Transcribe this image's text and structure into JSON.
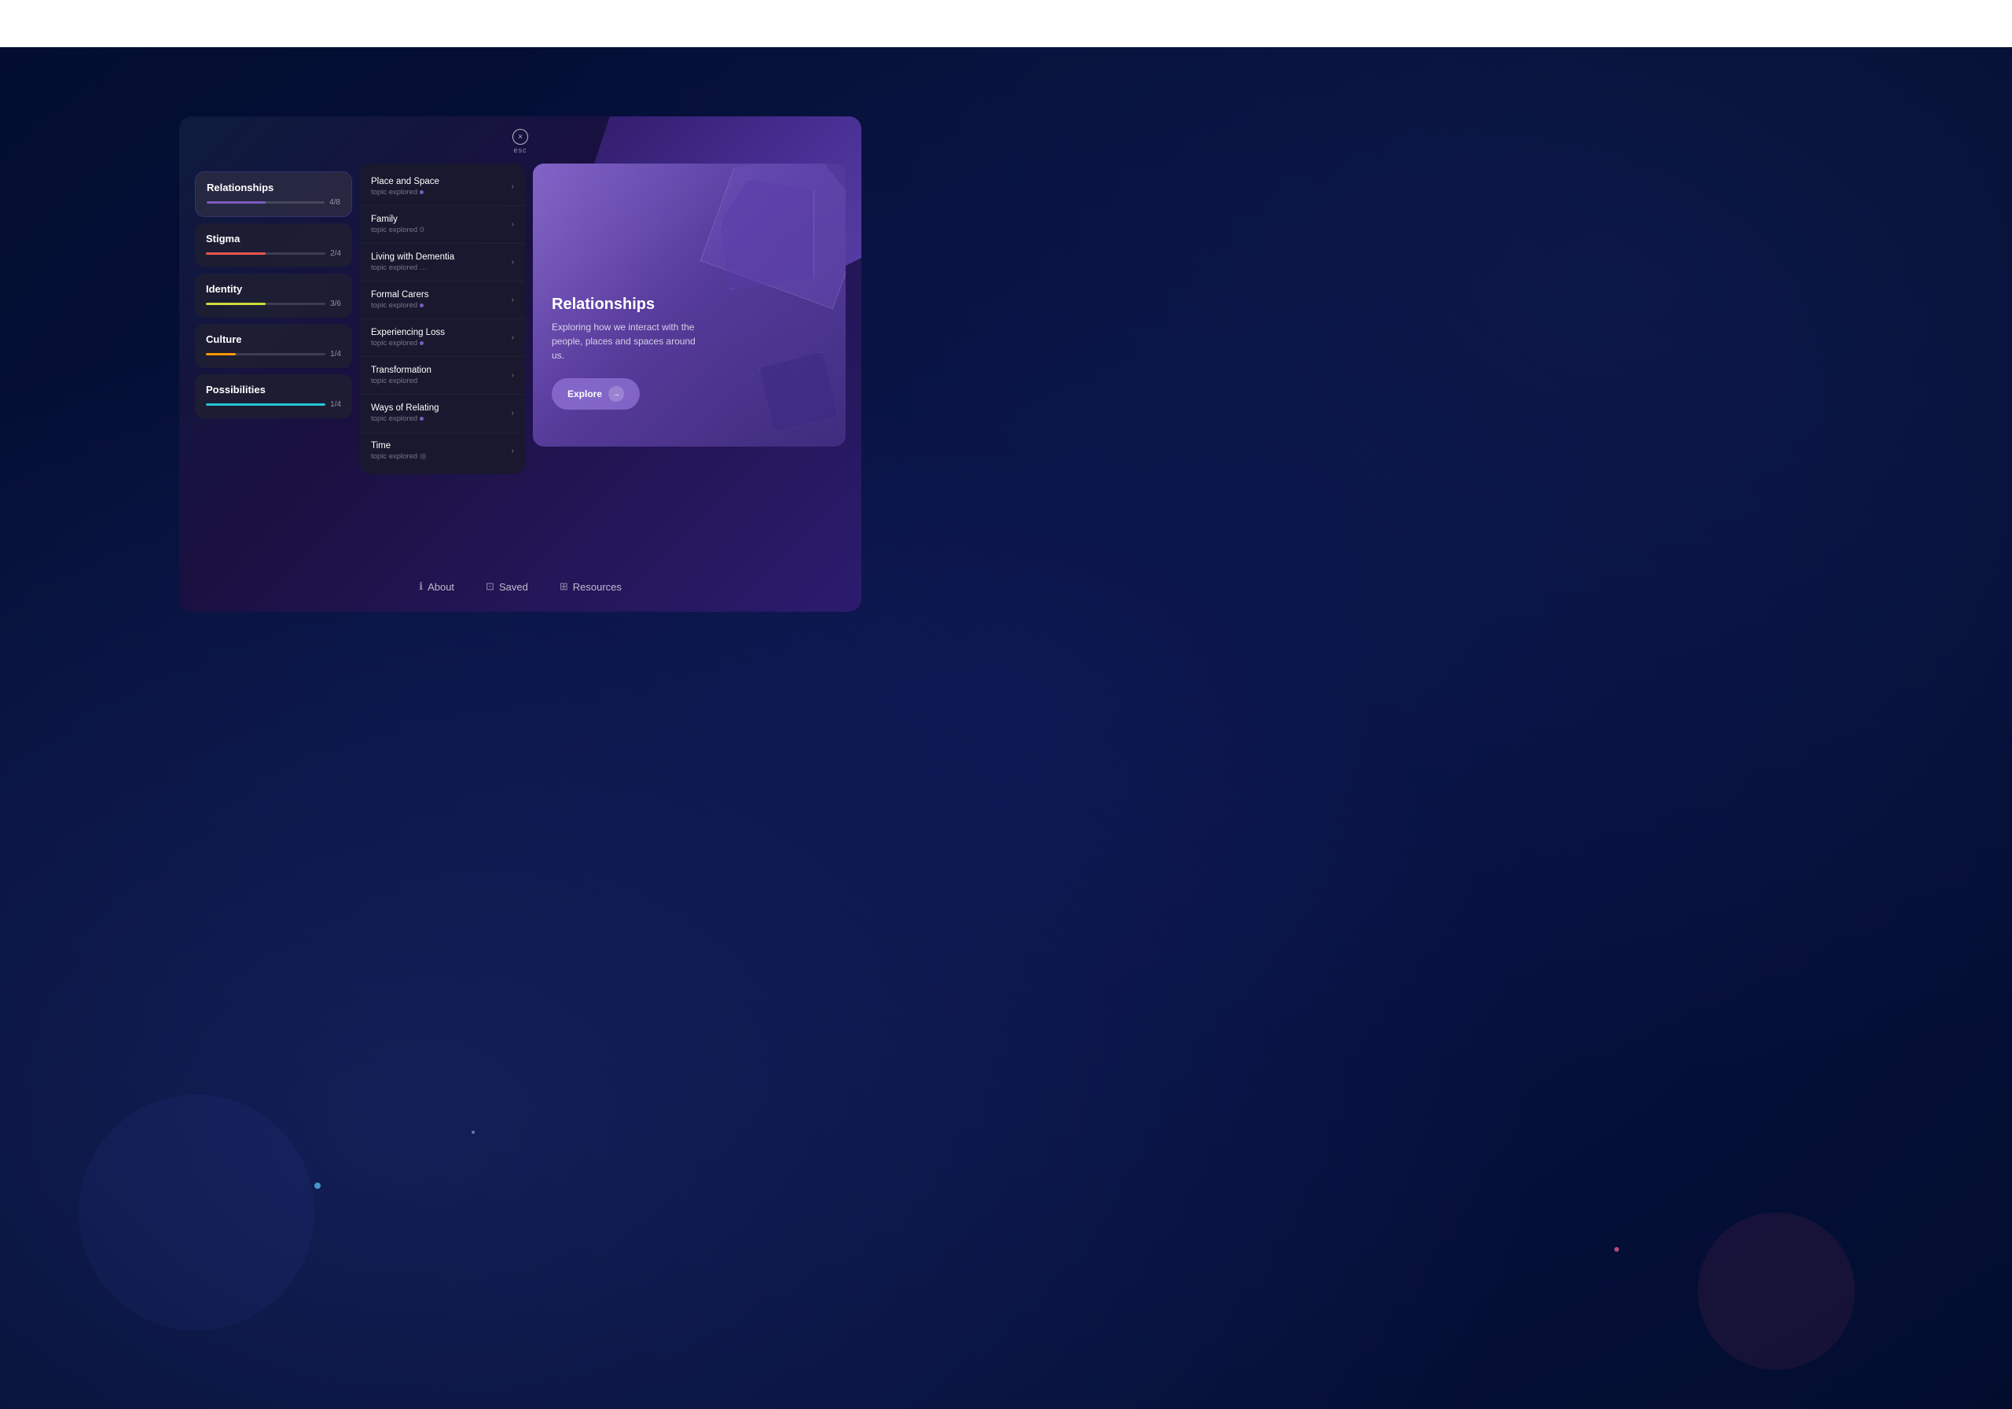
{
  "topBar": {},
  "closeButton": {
    "icon": "×",
    "label": "esc"
  },
  "categories": [
    {
      "name": "Relationships",
      "progress": 50,
      "maxProgress": 100,
      "label": "4/8",
      "color": "#7c5cbf",
      "active": true
    },
    {
      "name": "Stigma",
      "progress": 50,
      "maxProgress": 100,
      "label": "2/4",
      "color": "#ef5350",
      "active": false
    },
    {
      "name": "Identity",
      "progress": 50,
      "maxProgress": 100,
      "label": "3/6",
      "color": "#cddc39",
      "active": false
    },
    {
      "name": "Culture",
      "progress": 25,
      "maxProgress": 100,
      "label": "1/4",
      "color": "#ff9800",
      "active": false
    },
    {
      "name": "Possibilities",
      "progress": 100,
      "maxProgress": 100,
      "label": "1/4",
      "color": "#26c6da",
      "active": false
    }
  ],
  "topics": [
    {
      "name": "Place and Space",
      "sub": "topic explored",
      "dotType": "purple",
      "dotLabel": "●"
    },
    {
      "name": "Family",
      "sub": "topic explored",
      "dotType": "empty",
      "dotLabel": "0"
    },
    {
      "name": "Living with Dementia",
      "sub": "topic explored",
      "dotType": "empty",
      "dotLabel": "…"
    },
    {
      "name": "Formal Carers",
      "sub": "topic explored",
      "dotType": "purple",
      "dotLabel": "●"
    },
    {
      "name": "Experiencing Loss",
      "sub": "topic explored",
      "dotType": "purple",
      "dotLabel": "●"
    },
    {
      "name": "Transformation",
      "sub": "topic explored",
      "dotType": "empty",
      "dotLabel": ""
    },
    {
      "name": "Ways of Relating",
      "sub": "topic explored",
      "dotType": "purple",
      "dotLabel": "●"
    },
    {
      "name": "Time",
      "sub": "topic explored",
      "dotType": "empty",
      "dotLabel": "◎"
    }
  ],
  "detail": {
    "title": "Relationships",
    "description": "Exploring how we interact with the people, places and spaces around us.",
    "exploreLabel": "Explore",
    "exploreArrow": "→"
  },
  "bottomNav": [
    {
      "icon": "ℹ",
      "label": "About"
    },
    {
      "icon": "⊡",
      "label": "Saved"
    },
    {
      "icon": "⊞",
      "label": "Resources"
    }
  ]
}
